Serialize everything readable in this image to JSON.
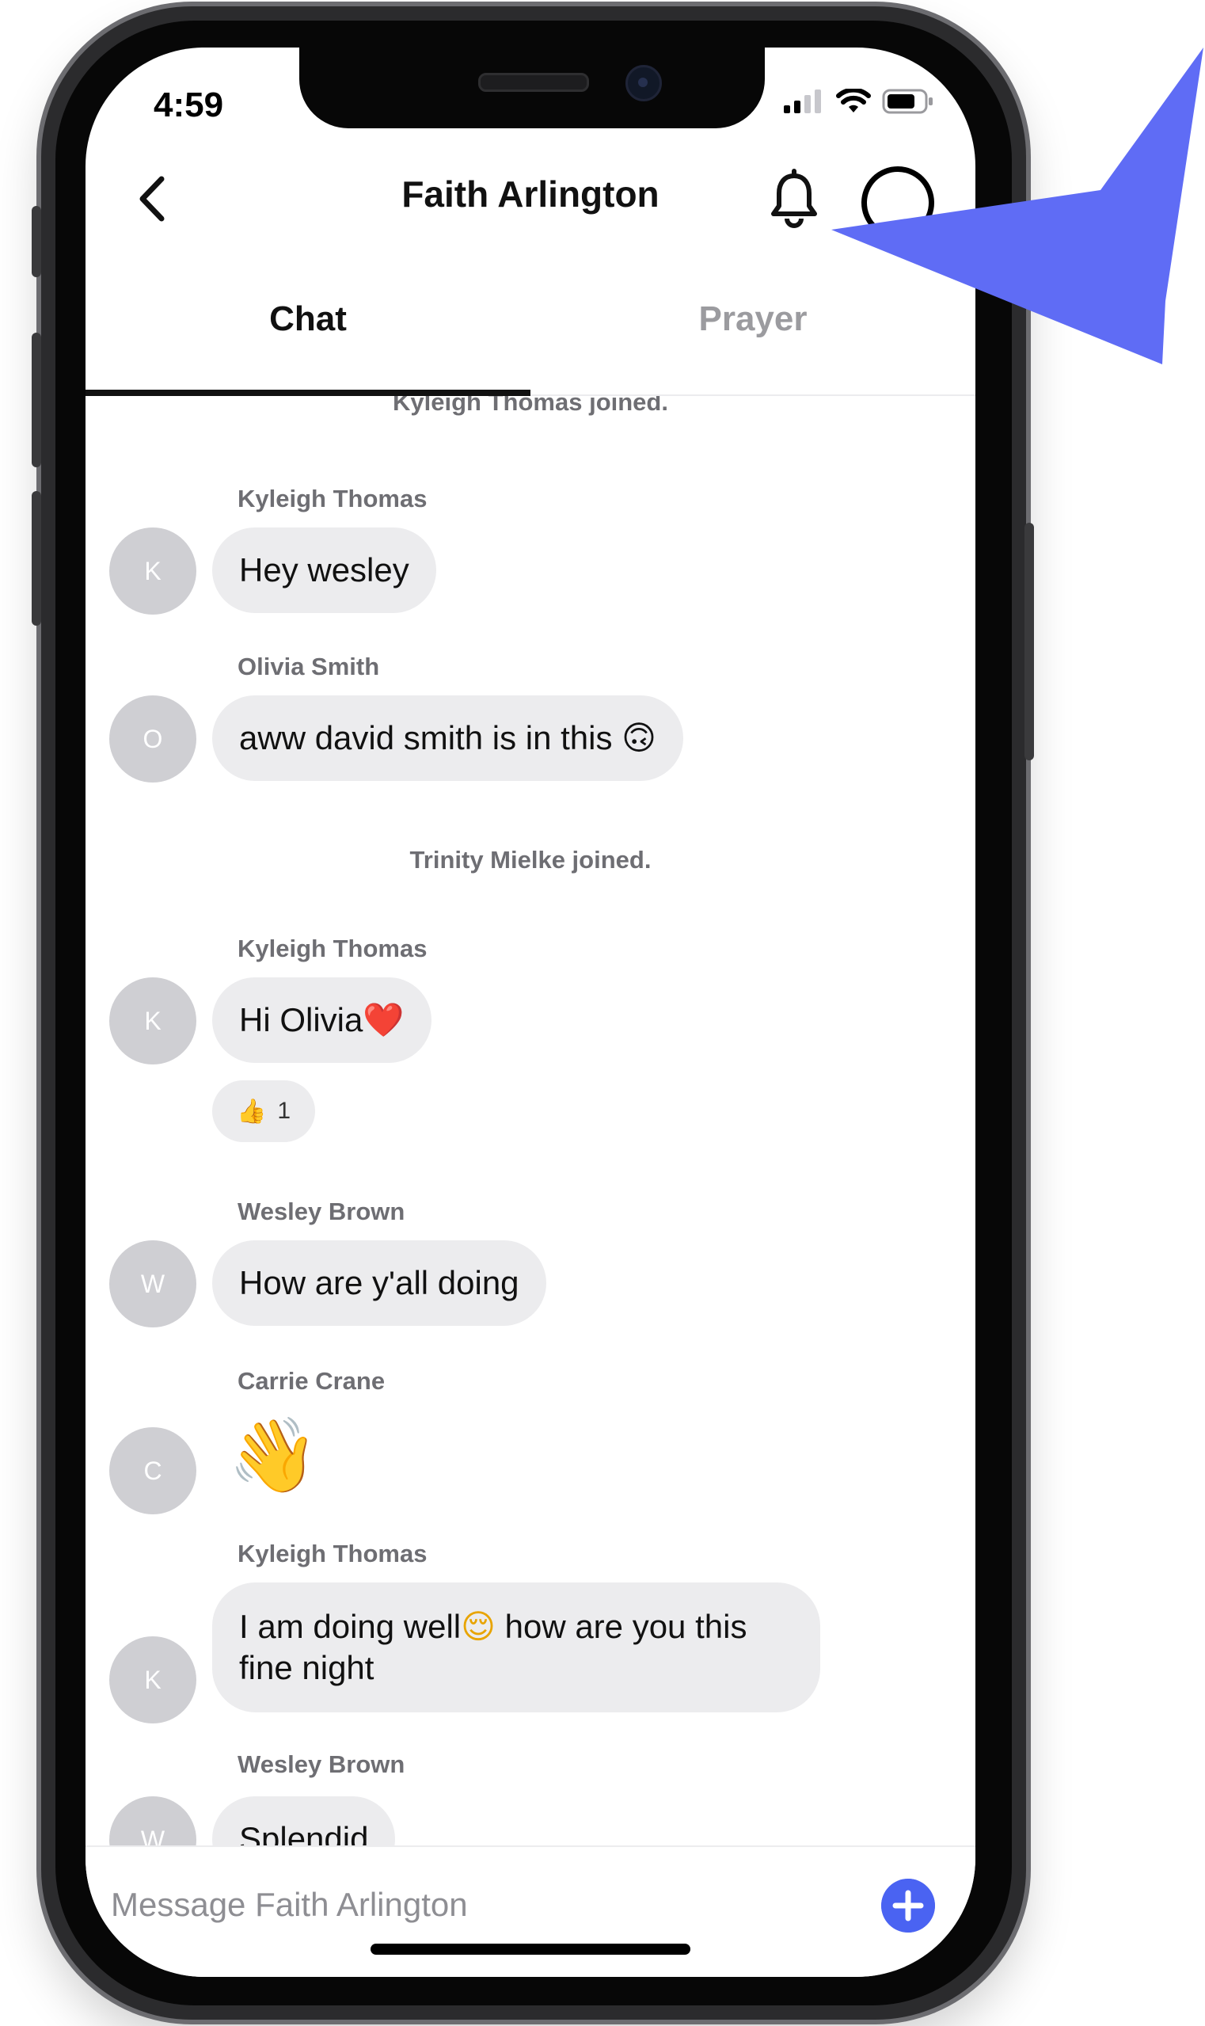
{
  "status_bar": {
    "time": "4:59"
  },
  "header": {
    "title": "Faith Arlington"
  },
  "tabs": [
    {
      "label": "Chat"
    },
    {
      "label": "Prayer"
    }
  ],
  "messages": {
    "system_top": "Kyleigh Thomas joined.",
    "m1": {
      "sender": "Kyleigh Thomas",
      "initial": "K",
      "text": "Hey wesley"
    },
    "m2": {
      "sender": "Olivia Smith",
      "initial": "O",
      "text": "aww david smith is in this",
      "emoji": "🙃"
    },
    "system_mid": "Trinity Mielke joined.",
    "m3": {
      "sender": "Kyleigh Thomas",
      "initial": "K",
      "text": "Hi Olivia",
      "emoji": "❤️",
      "reaction_emoji": "👍",
      "reaction_count": "1"
    },
    "m4": {
      "sender": "Wesley Brown",
      "initial": "W",
      "text": "How are y'all doing"
    },
    "m5": {
      "sender": "Carrie Crane",
      "initial": "C",
      "emoji": "👋"
    },
    "m6": {
      "sender": "Kyleigh Thomas",
      "initial": "K",
      "text_a": "I am doing well",
      "emoji": "😌",
      "text_b": " how are you this fine night"
    },
    "m7": {
      "sender": "Wesley Brown",
      "initial": "W",
      "text": "Splendid"
    }
  },
  "composer": {
    "placeholder": "Message Faith Arlington"
  },
  "colors": {
    "accent": "#4a63f2",
    "pointer": "#5f6cf5",
    "bubble": "#ececee"
  }
}
